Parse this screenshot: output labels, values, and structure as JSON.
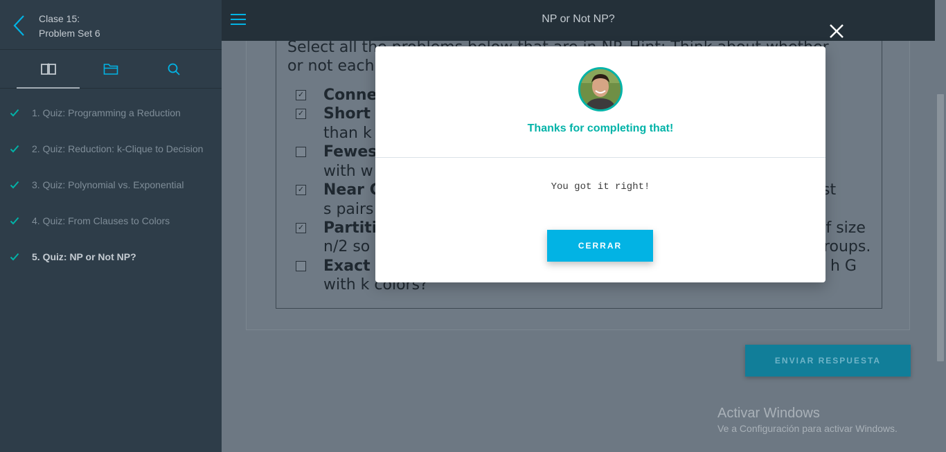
{
  "sidebar": {
    "course_line1": "Clase 15:",
    "course_line2": "Problem Set 6",
    "tabs": [
      {
        "icon": "book-icon",
        "active": true
      },
      {
        "icon": "folder-icon",
        "active": false
      },
      {
        "icon": "search-icon",
        "active": false
      }
    ],
    "items": [
      {
        "label": "1. Quiz: Programming a Reduction",
        "completed": true
      },
      {
        "label": "2. Quiz: Reduction: k-Clique to Decision",
        "completed": true
      },
      {
        "label": "3. Quiz: Polynomial vs. Exponential",
        "completed": true
      },
      {
        "label": "4. Quiz: From Clauses to Colors",
        "completed": true
      },
      {
        "label": "5. Quiz: NP or Not NP?",
        "completed": true,
        "current": true
      }
    ]
  },
  "header": {
    "title": "NP or Not NP?"
  },
  "quiz": {
    "intro_line1": "Select all the problems below that are in NP. Hint: Think about whether",
    "intro_line2": "or not each",
    "options": [
      {
        "checked": true,
        "line1_bold": "Conne"
      },
      {
        "checked": true,
        "line1_bold": "Short",
        "line2": "than k"
      },
      {
        "checked": false,
        "line1_bold": "Fewes",
        "line2": "with w"
      },
      {
        "checked": true,
        "line1_bold": "Near C",
        "line1_right": "st",
        "line2": "s pairs"
      },
      {
        "checked": true,
        "line1_bold": "Partiti",
        "line1_right": "of size",
        "line2": "n/2 so",
        "line2_right": "groups."
      },
      {
        "checked": false,
        "line1_bold": "Exact",
        "line1_right": "h G",
        "line2": "with k colors?"
      }
    ],
    "submit_label": "ENVIAR RESPUESTA"
  },
  "watermark": {
    "title": "Activar Windows",
    "subtitle": "Ve a Configuración para activar Windows."
  },
  "modal": {
    "heading": "Thanks for completing that!",
    "message": "You got it right!",
    "button_label": "CERRAR"
  },
  "colors": {
    "accent": "#02b3e4",
    "success": "#02b3a8",
    "sidebar_bg": "#2e3d49"
  }
}
